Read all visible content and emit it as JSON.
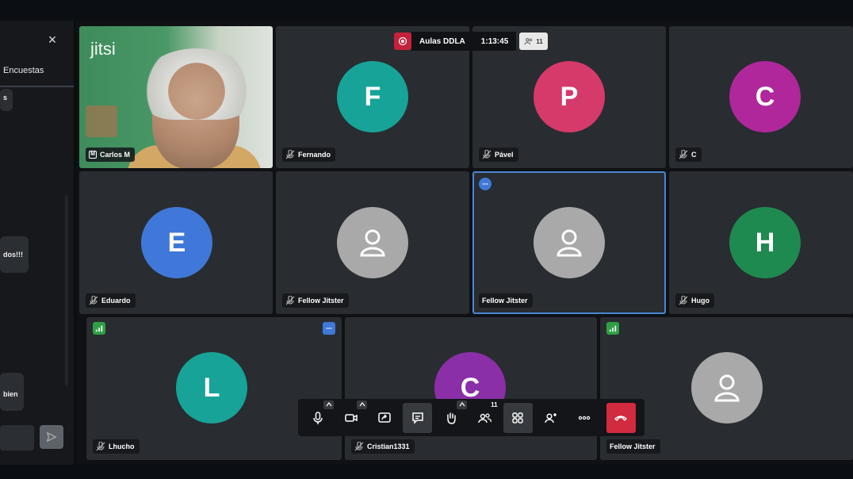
{
  "meeting": {
    "title": "Aulas DDLA",
    "timer": "1:13:45",
    "participant_count": "11",
    "recording": true,
    "app_logo": "jitsi"
  },
  "chat_panel": {
    "close_label": "×",
    "tab_label": "Encuestas",
    "messages": [
      "s",
      "dos!!!",
      "bien"
    ]
  },
  "participants": [
    {
      "name": "Carlos M",
      "type": "camera"
    },
    {
      "name": "Fernando",
      "initial": "F",
      "color": "#17a398"
    },
    {
      "name": "Pável",
      "initial": "P",
      "color": "#d63a6a"
    },
    {
      "name": "C",
      "initial": "C",
      "color": "#b0279c"
    },
    {
      "name": "Eduardo",
      "initial": "E",
      "color": "#3f78d8"
    },
    {
      "name": "Fellow Jitster",
      "initial": "",
      "color": "#a9a9a9"
    },
    {
      "name": "Fellow Jitster",
      "initial": "",
      "color": "#a9a9a9",
      "active": true
    },
    {
      "name": "Hugo",
      "initial": "H",
      "color": "#1f8a4f"
    },
    {
      "name": "Lhucho",
      "initial": "L",
      "color": "#17a398"
    },
    {
      "name": "Cristian1331",
      "initial": "C",
      "color": "#8a2fa8"
    },
    {
      "name": "Fellow Jitster",
      "initial": "",
      "color": "#a9a9a9"
    }
  ],
  "toolbar": {
    "participants_badge": "11",
    "buttons": [
      "microphone",
      "camera",
      "share-screen",
      "chat",
      "raise-hand",
      "participants",
      "tile-view",
      "invite",
      "more",
      "hangup"
    ]
  },
  "colors": {
    "accent": "#4a86d1",
    "hangup": "#d22a3f",
    "recording": "#c4213a"
  }
}
